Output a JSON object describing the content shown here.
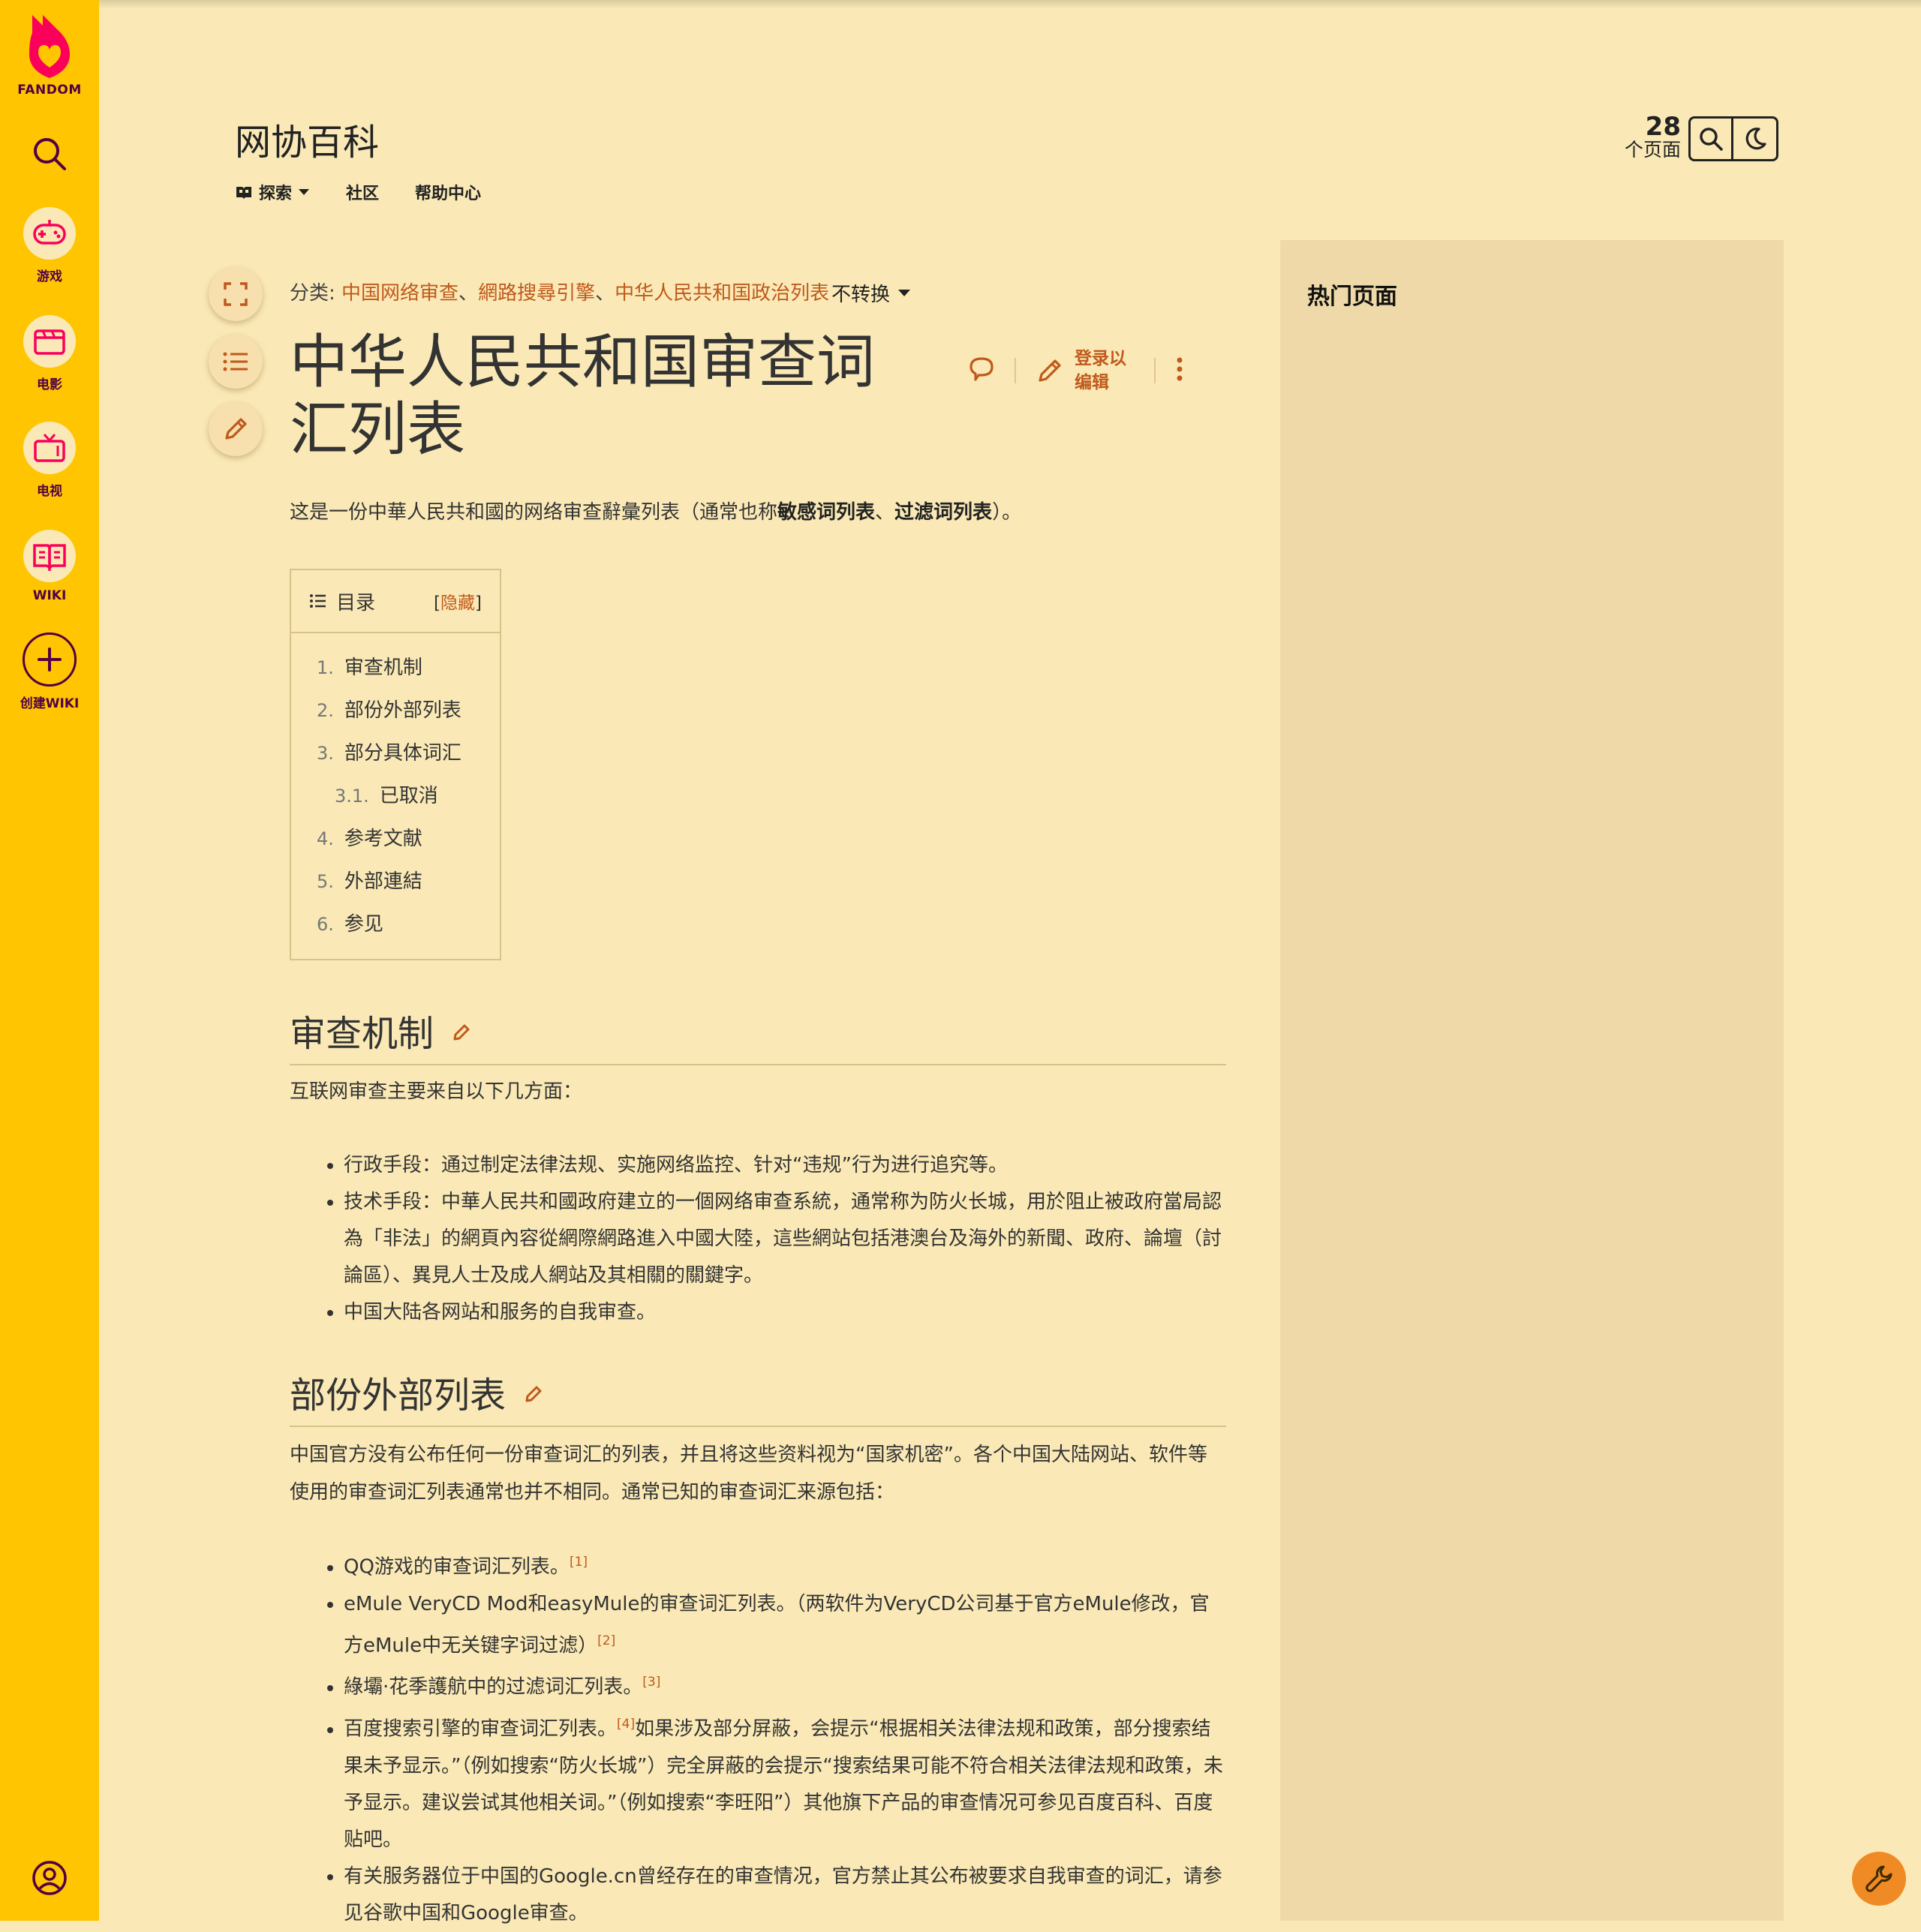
{
  "rail": {
    "brand": "FANDOM",
    "items": [
      {
        "label": "游戏",
        "icon": "controller-icon"
      },
      {
        "label": "电影",
        "icon": "clapperboard-icon"
      },
      {
        "label": "电视",
        "icon": "tv-icon"
      },
      {
        "label": "WIKI",
        "icon": "book-icon"
      },
      {
        "label": "创建WIKI",
        "icon": "plus-icon"
      }
    ]
  },
  "header": {
    "wiki_title": "网协百科",
    "nav": {
      "explore": "探索",
      "community": "社区",
      "help": "帮助中心"
    },
    "page_count": "28",
    "page_count_label": "个页面"
  },
  "page": {
    "categories_label": "分类:",
    "categories": [
      "中国网络审查",
      "網路搜尋引擎",
      "中华人民共和国政治列表"
    ],
    "category_sep": "、",
    "variant": "不转换",
    "title": "中华人民共和国审查词汇列表",
    "edit_login": "登录以编辑",
    "intro_pre": "这是一份中華人民共和國的网络审查辭彙列表（通常也称",
    "intro_b1": "敏感词列表",
    "intro_mid": "、",
    "intro_b2": "过滤词列表",
    "intro_post": "）。"
  },
  "toc": {
    "title": "目录",
    "hide_l": "[",
    "hide": "隐藏",
    "hide_r": "]",
    "items": [
      {
        "n": "1.",
        "t": "审查机制"
      },
      {
        "n": "2.",
        "t": "部份外部列表"
      },
      {
        "n": "3.",
        "t": "部分具体词汇"
      },
      {
        "n": "3.1.",
        "t": "已取消"
      },
      {
        "n": "4.",
        "t": "参考文献"
      },
      {
        "n": "5.",
        "t": "外部連結"
      },
      {
        "n": "6.",
        "t": "参见"
      }
    ]
  },
  "sections": {
    "s1": {
      "heading": "审查机制",
      "intro": "互联网审查主要来自以下几方面：",
      "bullets": [
        "行政手段：通过制定法律法规、实施网络监控、针对“违规”行为进行追究等。",
        "技术手段：中華人民共和國政府建立的一個网络审查系統，通常称为防火长城，用於阻止被政府當局認為「非法」的網頁內容從網際網路進入中國大陸，這些網站包括港澳台及海外的新聞、政府、論壇（討論區）、異見人士及成人網站及其相關的關鍵字。",
        "中国大陆各网站和服务的自我审查。"
      ]
    },
    "s2": {
      "heading": "部份外部列表",
      "intro": "中国官方没有公布任何一份审查词汇的列表，并且将这些资料视为“国家机密”。各个中国大陆网站、软件等使用的审查词汇列表通常也并不相同。通常已知的审查词汇来源包括：",
      "b1": "QQ游戏的审查词汇列表。",
      "b1_ref": "[1]",
      "b2": "eMule VeryCD Mod和easyMule的审查词汇列表。（两软件为VeryCD公司基于官方eMule修改，官方eMule中无关键字词过滤）",
      "b2_ref": "[2]",
      "b3": "綠壩·花季護航中的过滤词汇列表。",
      "b3_ref": "[3]",
      "b4_pre": "百度搜索引擎的审查词汇列表。",
      "b4_ref": "[4]",
      "b4_post": "如果涉及部分屏蔽，会提示“根据相关法律法规和政策，部分搜索结果未予显示。”（例如搜索“防火长城”）完全屏蔽的会提示“搜索结果可能不符合相关法律法规和政策，未予显示。建议尝试其他相关词。”（例如搜索“李旺阳”）其他旗下产品的审查情况可参见百度百科、百度贴吧。",
      "b5": "有关服务器位于中国的Google.cn曾经存在的审查情况，官方禁止其公布被要求自我审查的词汇，请参见谷歌中国和Google审查。"
    }
  },
  "right_rail": {
    "title": "热门页面"
  },
  "colors": {
    "rail": "#ffc500",
    "background": "#fae9b6",
    "accent": "#c0591c",
    "brand": "#520044"
  }
}
